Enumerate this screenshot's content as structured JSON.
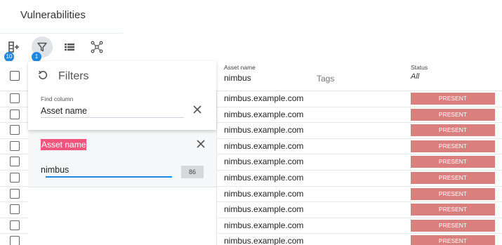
{
  "page": {
    "title": "Vulnerabilities"
  },
  "toolbar": {
    "columns_badge": "10",
    "filter_badge": "1"
  },
  "header": {
    "asset_name_label": "Asset name",
    "asset_name_filter": "nimbus",
    "tags_label": "Tags",
    "status_label": "Status",
    "status_filter": "All"
  },
  "filters": {
    "title": "Filters",
    "find_label": "Find column",
    "find_value": "Asset name",
    "active_filter": {
      "column": "Asset name",
      "value": "nimbus",
      "count": "86"
    }
  },
  "rows": [
    {
      "asset": "nimbus.example.com",
      "status": "PRESENT"
    },
    {
      "asset": "nimbus.example.com",
      "status": "PRESENT"
    },
    {
      "asset": "nimbus.example.com",
      "status": "PRESENT"
    },
    {
      "asset": "nimbus.example.com",
      "status": "PRESENT"
    },
    {
      "asset": "nimbus.example.com",
      "status": "PRESENT"
    },
    {
      "asset": "nimbus.example.com",
      "status": "PRESENT"
    },
    {
      "asset": "nimbus.example.com",
      "status": "PRESENT"
    },
    {
      "asset": "nimbus.example.com",
      "status": "PRESENT"
    },
    {
      "asset": "nimbus.example.com",
      "status": "PRESENT"
    },
    {
      "asset": "nimbus.example.com",
      "status": "PRESENT"
    }
  ],
  "colors": {
    "status_present": "#d9807f",
    "filter_chip": "#f0567d",
    "accent": "#1e88e5"
  },
  "icons": {
    "columns": "view-column-add-icon",
    "filter": "filter-icon",
    "list": "view-list-icon",
    "graph": "graph-network-icon",
    "reset": "reset-icon",
    "close": "close-icon"
  }
}
